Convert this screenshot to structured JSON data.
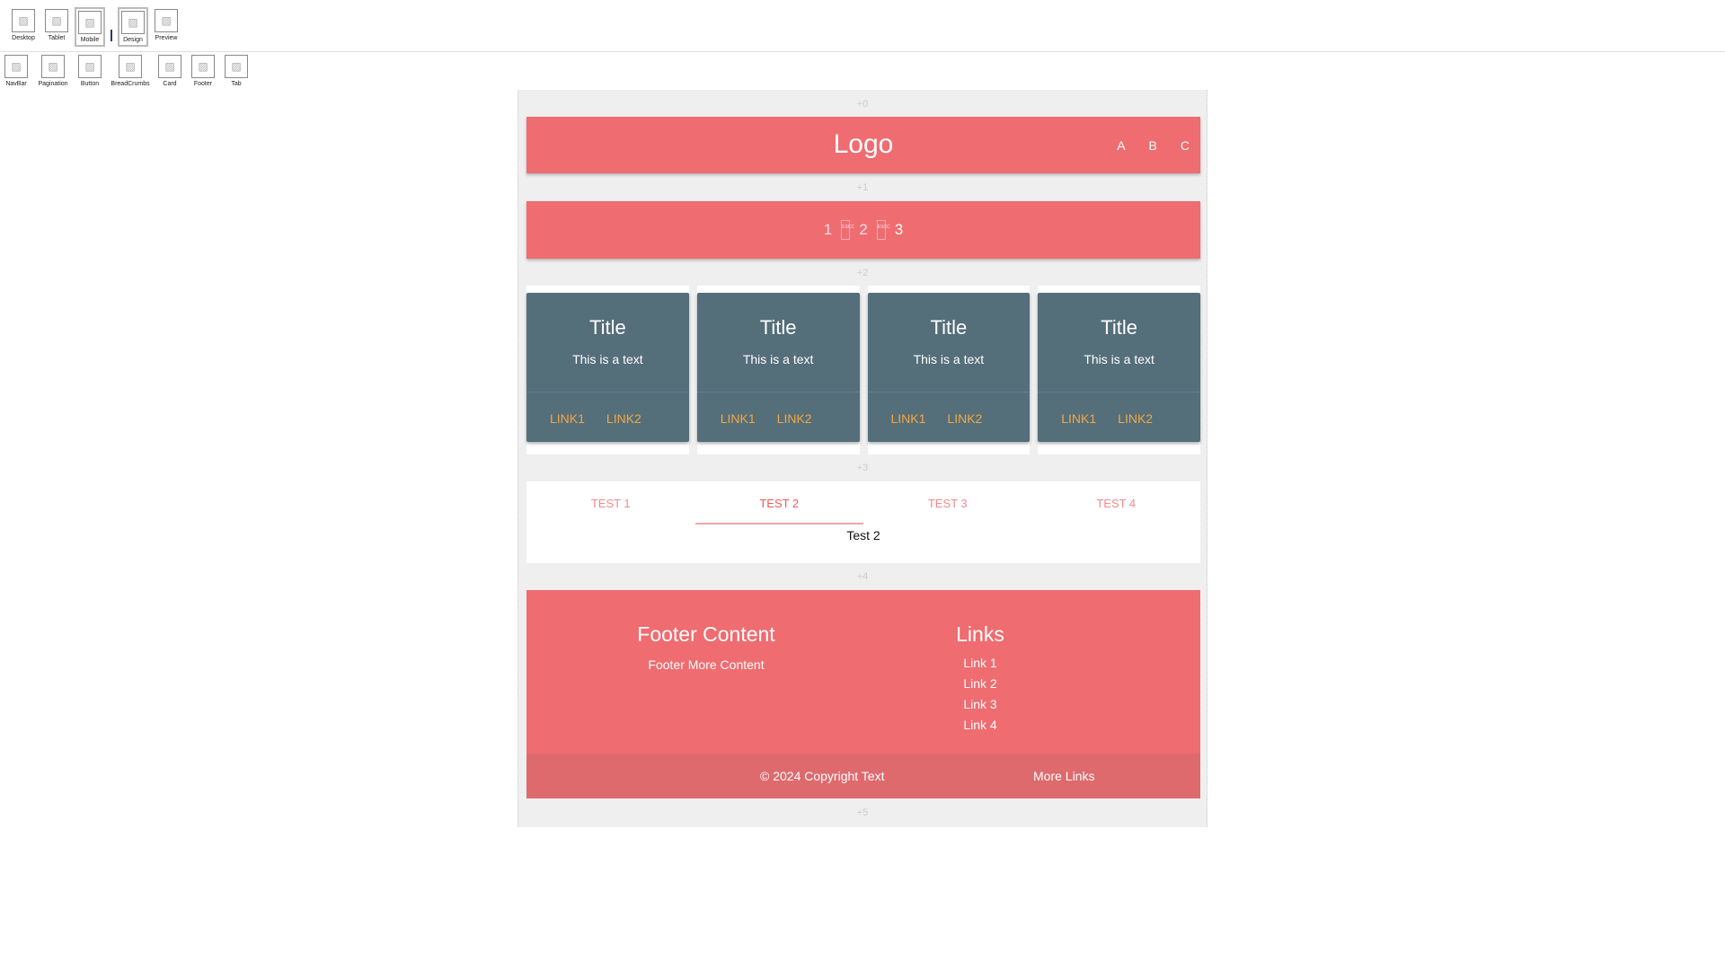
{
  "toolbar_top": [
    {
      "label": "Desktop"
    },
    {
      "label": "Tablet"
    },
    {
      "label": "Mobile"
    },
    {
      "label": "Design"
    },
    {
      "label": "Preview"
    }
  ],
  "toolbar_components": [
    {
      "label": "NavBar"
    },
    {
      "label": "Pagination"
    },
    {
      "label": "Button"
    },
    {
      "label": "BreadCrumbs"
    },
    {
      "label": "Card"
    },
    {
      "label": "Footer"
    },
    {
      "label": "Tab"
    }
  ],
  "drop_markers": [
    "+0",
    "+1",
    "+2",
    "+3",
    "+4",
    "+5"
  ],
  "navbar": {
    "logo": "Logo",
    "links": [
      "A",
      "B",
      "C"
    ]
  },
  "pagination": {
    "pages": [
      "1",
      "2",
      "3"
    ],
    "separator_icon": "ESCC"
  },
  "cards": [
    {
      "title": "Title",
      "text": "This is a text",
      "link1": "LINK1",
      "link2": "LINK2"
    },
    {
      "title": "Title",
      "text": "This is a text",
      "link1": "LINK1",
      "link2": "LINK2"
    },
    {
      "title": "Title",
      "text": "This is a text",
      "link1": "LINK1",
      "link2": "LINK2"
    },
    {
      "title": "Title",
      "text": "This is a text",
      "link1": "LINK1",
      "link2": "LINK2"
    }
  ],
  "tabs": {
    "items": [
      "TEST 1",
      "TEST 2",
      "TEST 3",
      "TEST 4"
    ],
    "active": 1,
    "content": "Test 2"
  },
  "footer": {
    "heading": "Footer Content",
    "text": "Footer More Content",
    "links_heading": "Links",
    "links": [
      "Link 1",
      "Link 2",
      "Link 3",
      "Link 4"
    ],
    "copyright": "© 2024 Copyright Text",
    "more_links": "More Links"
  },
  "colors": {
    "primary": "#ef6c70",
    "card": "#546e7a",
    "link": "#f5a742"
  }
}
